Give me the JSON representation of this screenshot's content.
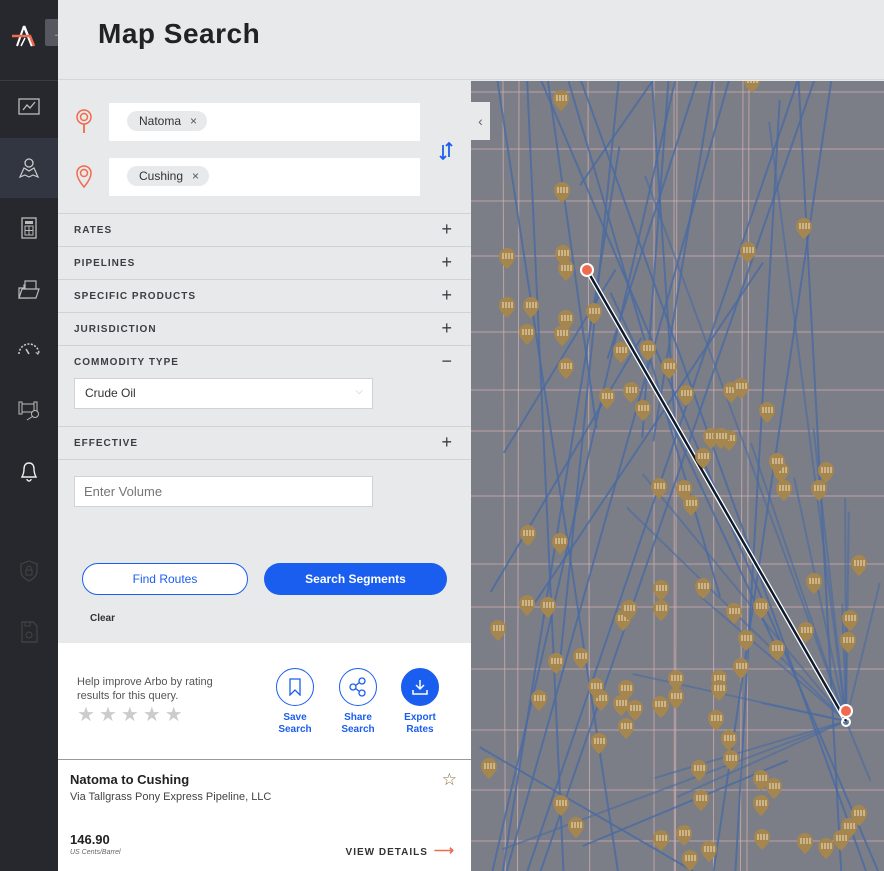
{
  "header": {
    "title": "Map Search",
    "expand_icon": "arrow-right-icon"
  },
  "sidebar": {
    "items": [
      {
        "name": "analytics",
        "icon": "chart-icon"
      },
      {
        "name": "map-search",
        "icon": "map-pin-icon",
        "active": true
      },
      {
        "name": "tariffs",
        "icon": "calculator-icon"
      },
      {
        "name": "documents",
        "icon": "folder-document-icon"
      },
      {
        "name": "dashboard",
        "icon": "gauge-icon"
      },
      {
        "name": "pipeline-search",
        "icon": "pipeline-search-icon"
      },
      {
        "name": "alerts",
        "icon": "bell-icon"
      },
      {
        "name": "security",
        "icon": "shield-lock-icon",
        "disabled": true
      },
      {
        "name": "saved",
        "icon": "file-check-icon",
        "disabled": true
      }
    ]
  },
  "search": {
    "origin": {
      "chip": "Natoma",
      "remove": "×"
    },
    "destination": {
      "chip": "Cushing",
      "remove": "×"
    },
    "swap_icon": "swap-arrows-icon"
  },
  "filters": [
    {
      "label": "RATES",
      "state": "+"
    },
    {
      "label": "PIPELINES",
      "state": "+"
    },
    {
      "label": "SPECIFIC PRODUCTS",
      "state": "+"
    },
    {
      "label": "JURISDICTION",
      "state": "+"
    },
    {
      "label": "COMMODITY TYPE",
      "state": "−"
    },
    {
      "label": "EFFECTIVE",
      "state": "+"
    }
  ],
  "commodity": {
    "selected": "Crude Oil",
    "chevron": "⌵"
  },
  "volume": {
    "placeholder": "Enter Volume",
    "value": ""
  },
  "buttons": {
    "find_routes": "Find Routes",
    "search_segments": "Search Segments",
    "clear": "Clear"
  },
  "rating": {
    "help": "Help improve Arbo by rating results for this query.",
    "stars": 5,
    "rated": 0
  },
  "actions": [
    {
      "line1": "Save",
      "line2": "Search",
      "icon": "bookmark-icon"
    },
    {
      "line1": "Share",
      "line2": "Search",
      "icon": "share-icon"
    },
    {
      "line1": "Export",
      "line2": "Rates",
      "icon": "download-icon"
    }
  ],
  "result": {
    "route": "Natoma to Cushing",
    "via": "Via Tallgrass Pony Express Pipeline, LLC",
    "price": "146.90",
    "unit": "US Cents/Barrel",
    "view_details": "VIEW DETAILS",
    "arrow": "⟶"
  },
  "map": {
    "collapse": "‹",
    "colors": {
      "pin": "#f06a4d",
      "terminal": "#a5864f",
      "pipeline": "#4a6ba3",
      "route": "#0d1a2e",
      "border": "#d9b2b2"
    }
  }
}
